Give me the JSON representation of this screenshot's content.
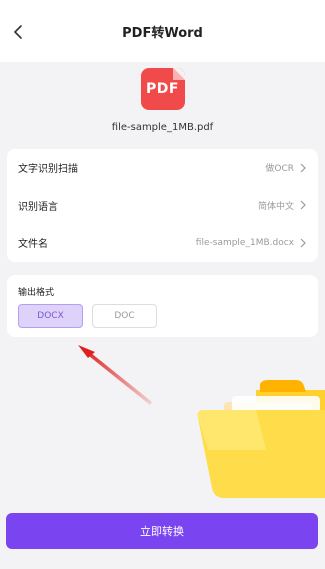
{
  "header": {
    "title": "PDF转Word",
    "back_icon": "chevron-left-icon"
  },
  "file": {
    "icon_text": "PDF",
    "name": "file-sample_1MB.pdf"
  },
  "settings": [
    {
      "label": "文字识别扫描",
      "value": "做OCR"
    },
    {
      "label": "识别语言",
      "value": "简体中文"
    },
    {
      "label": "文件名",
      "value": "file-sample_1MB.docx"
    }
  ],
  "output_format": {
    "label": "输出格式",
    "options": [
      "DOCX",
      "DOC"
    ],
    "selected": "DOCX"
  },
  "convert_button": "立即转换",
  "colors": {
    "accent": "#7a45f0",
    "selected_bg": "#ddd3fa",
    "pdf_red": "#f04a4a",
    "annotation_arrow": "#e02020"
  }
}
